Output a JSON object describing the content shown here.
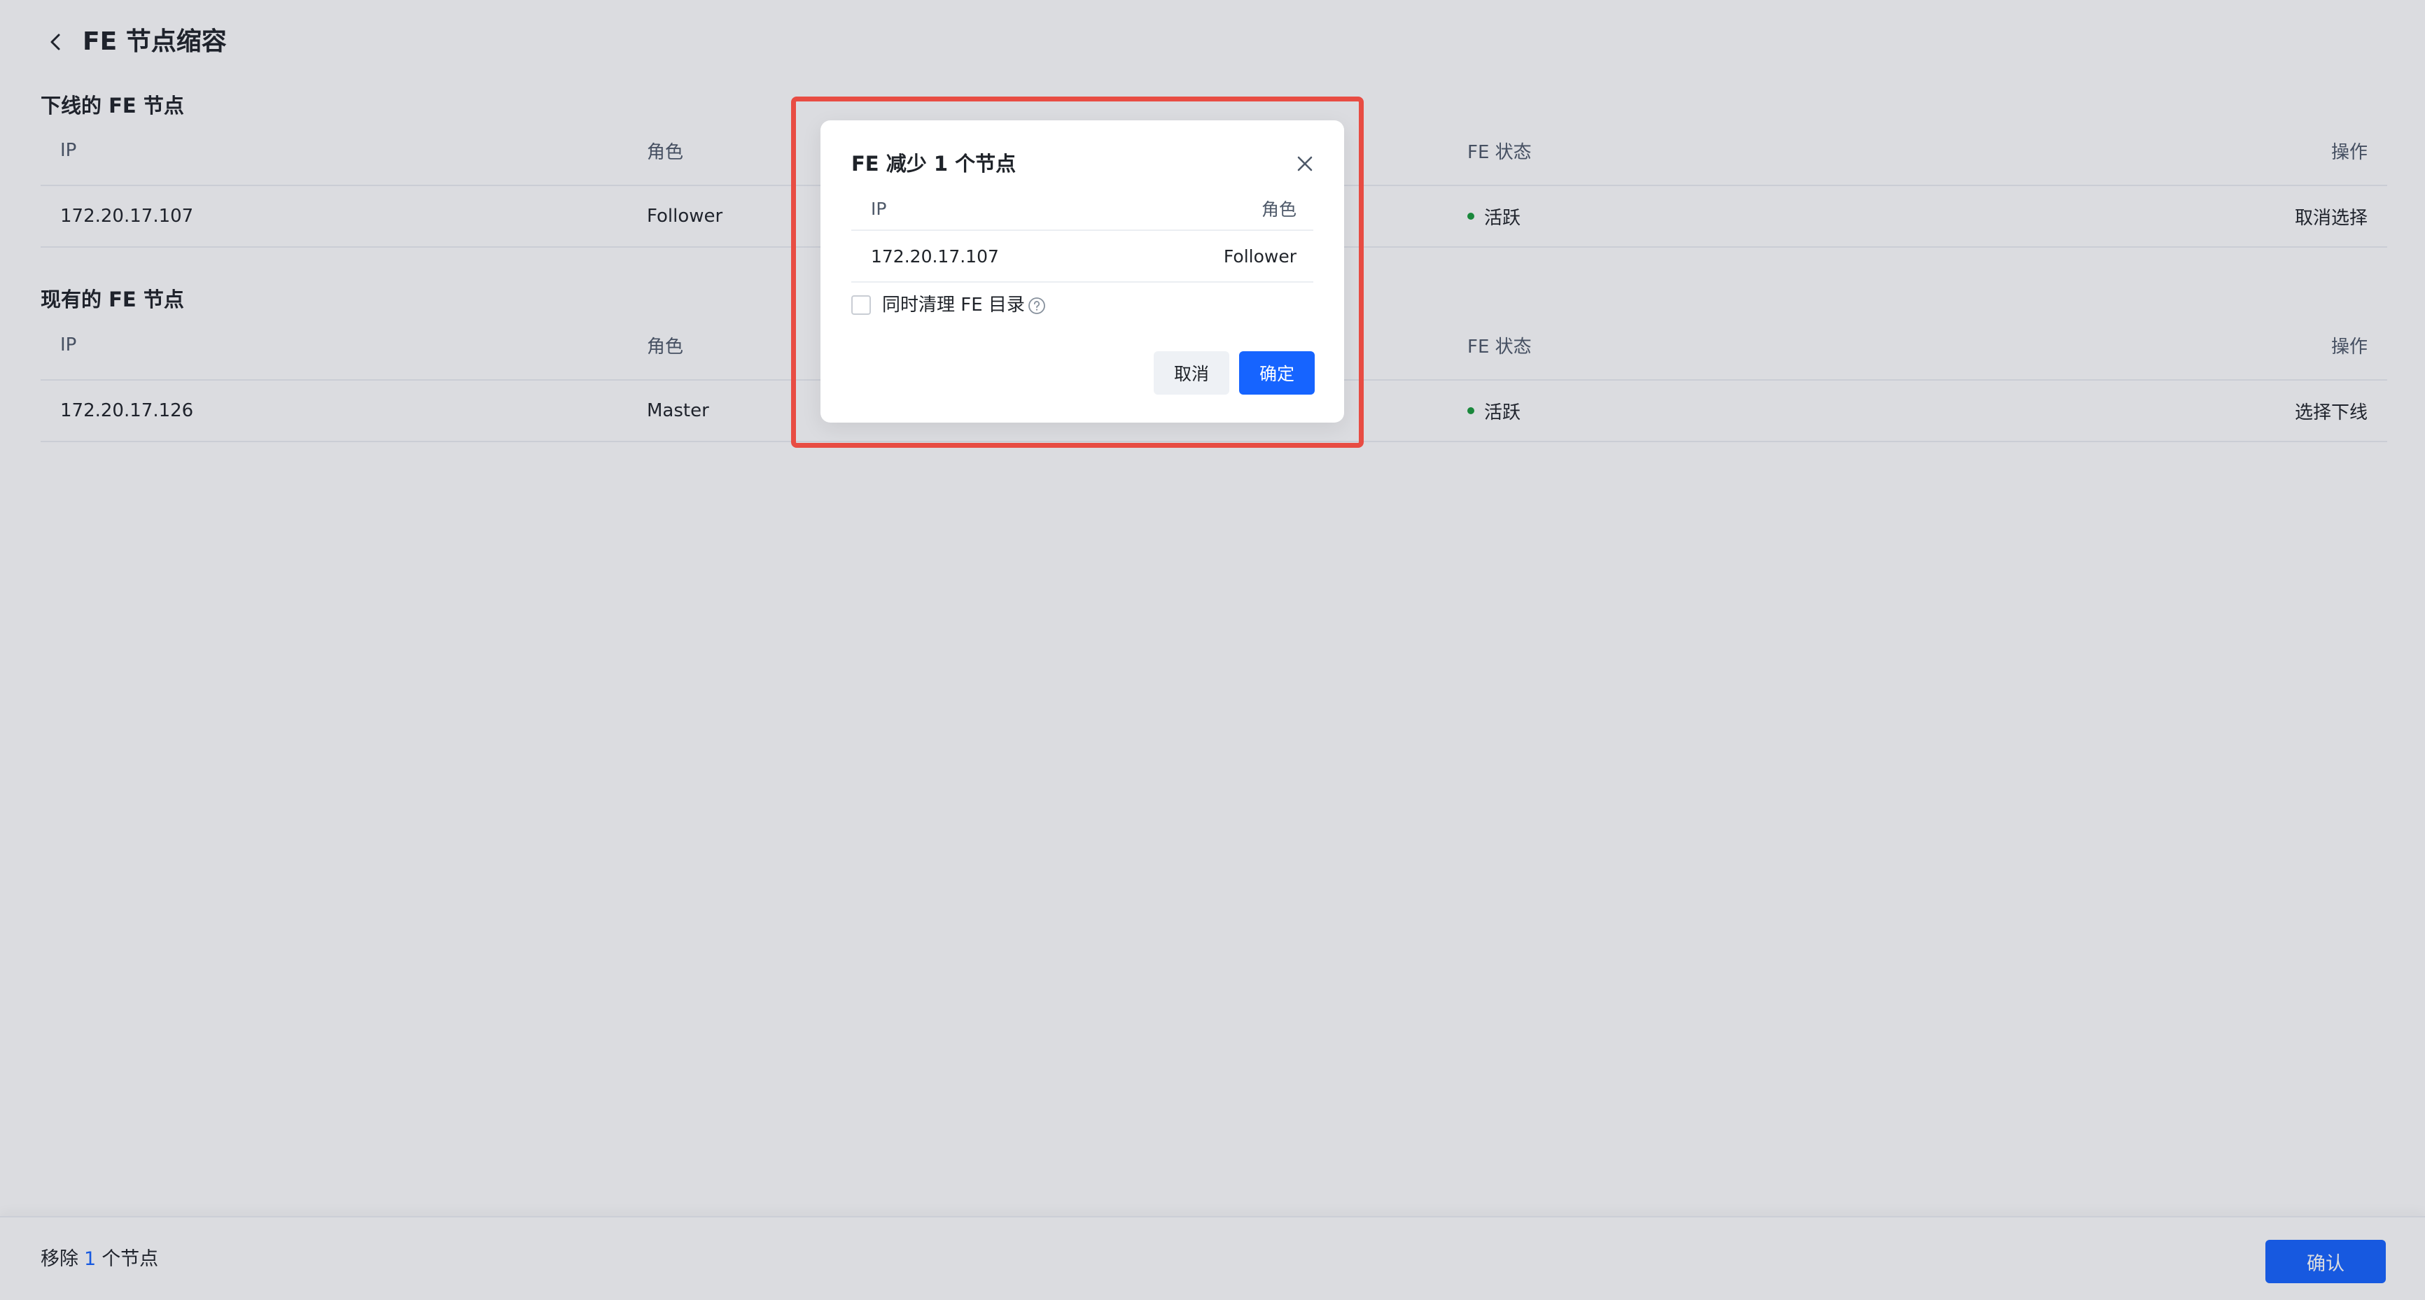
{
  "header": {
    "title": "FE 节点缩容"
  },
  "offline_section": {
    "title": "下线的 FE 节点",
    "columns": {
      "ip": "IP",
      "role": "角色",
      "status": "FE 状态",
      "action": "操作"
    },
    "rows": [
      {
        "ip": "172.20.17.107",
        "role": "Follower",
        "status": "活跃",
        "action": "取消选择"
      }
    ]
  },
  "existing_section": {
    "title": "现有的 FE 节点",
    "columns": {
      "ip": "IP",
      "role": "角色",
      "status": "FE 状态",
      "action": "操作"
    },
    "rows": [
      {
        "ip": "172.20.17.126",
        "role": "Master",
        "status": "活跃",
        "action": "选择下线"
      }
    ]
  },
  "footer": {
    "prefix": "移除",
    "count": "1",
    "suffix": "个节点",
    "confirm_label": "确认"
  },
  "dialog": {
    "title": "FE 减少 1 个节点",
    "columns": {
      "ip": "IP",
      "role": "角色"
    },
    "rows": [
      {
        "ip": "172.20.17.107",
        "role": "Follower"
      }
    ],
    "checkbox_label": "同时清理 FE 目录",
    "checkbox_checked": false,
    "cancel_label": "取消",
    "ok_label": "确定"
  },
  "colors": {
    "primary": "#1664ff",
    "status_active": "#1a9b3c",
    "highlight": "#e84c43",
    "disabled_link": "#a9c4f7"
  }
}
